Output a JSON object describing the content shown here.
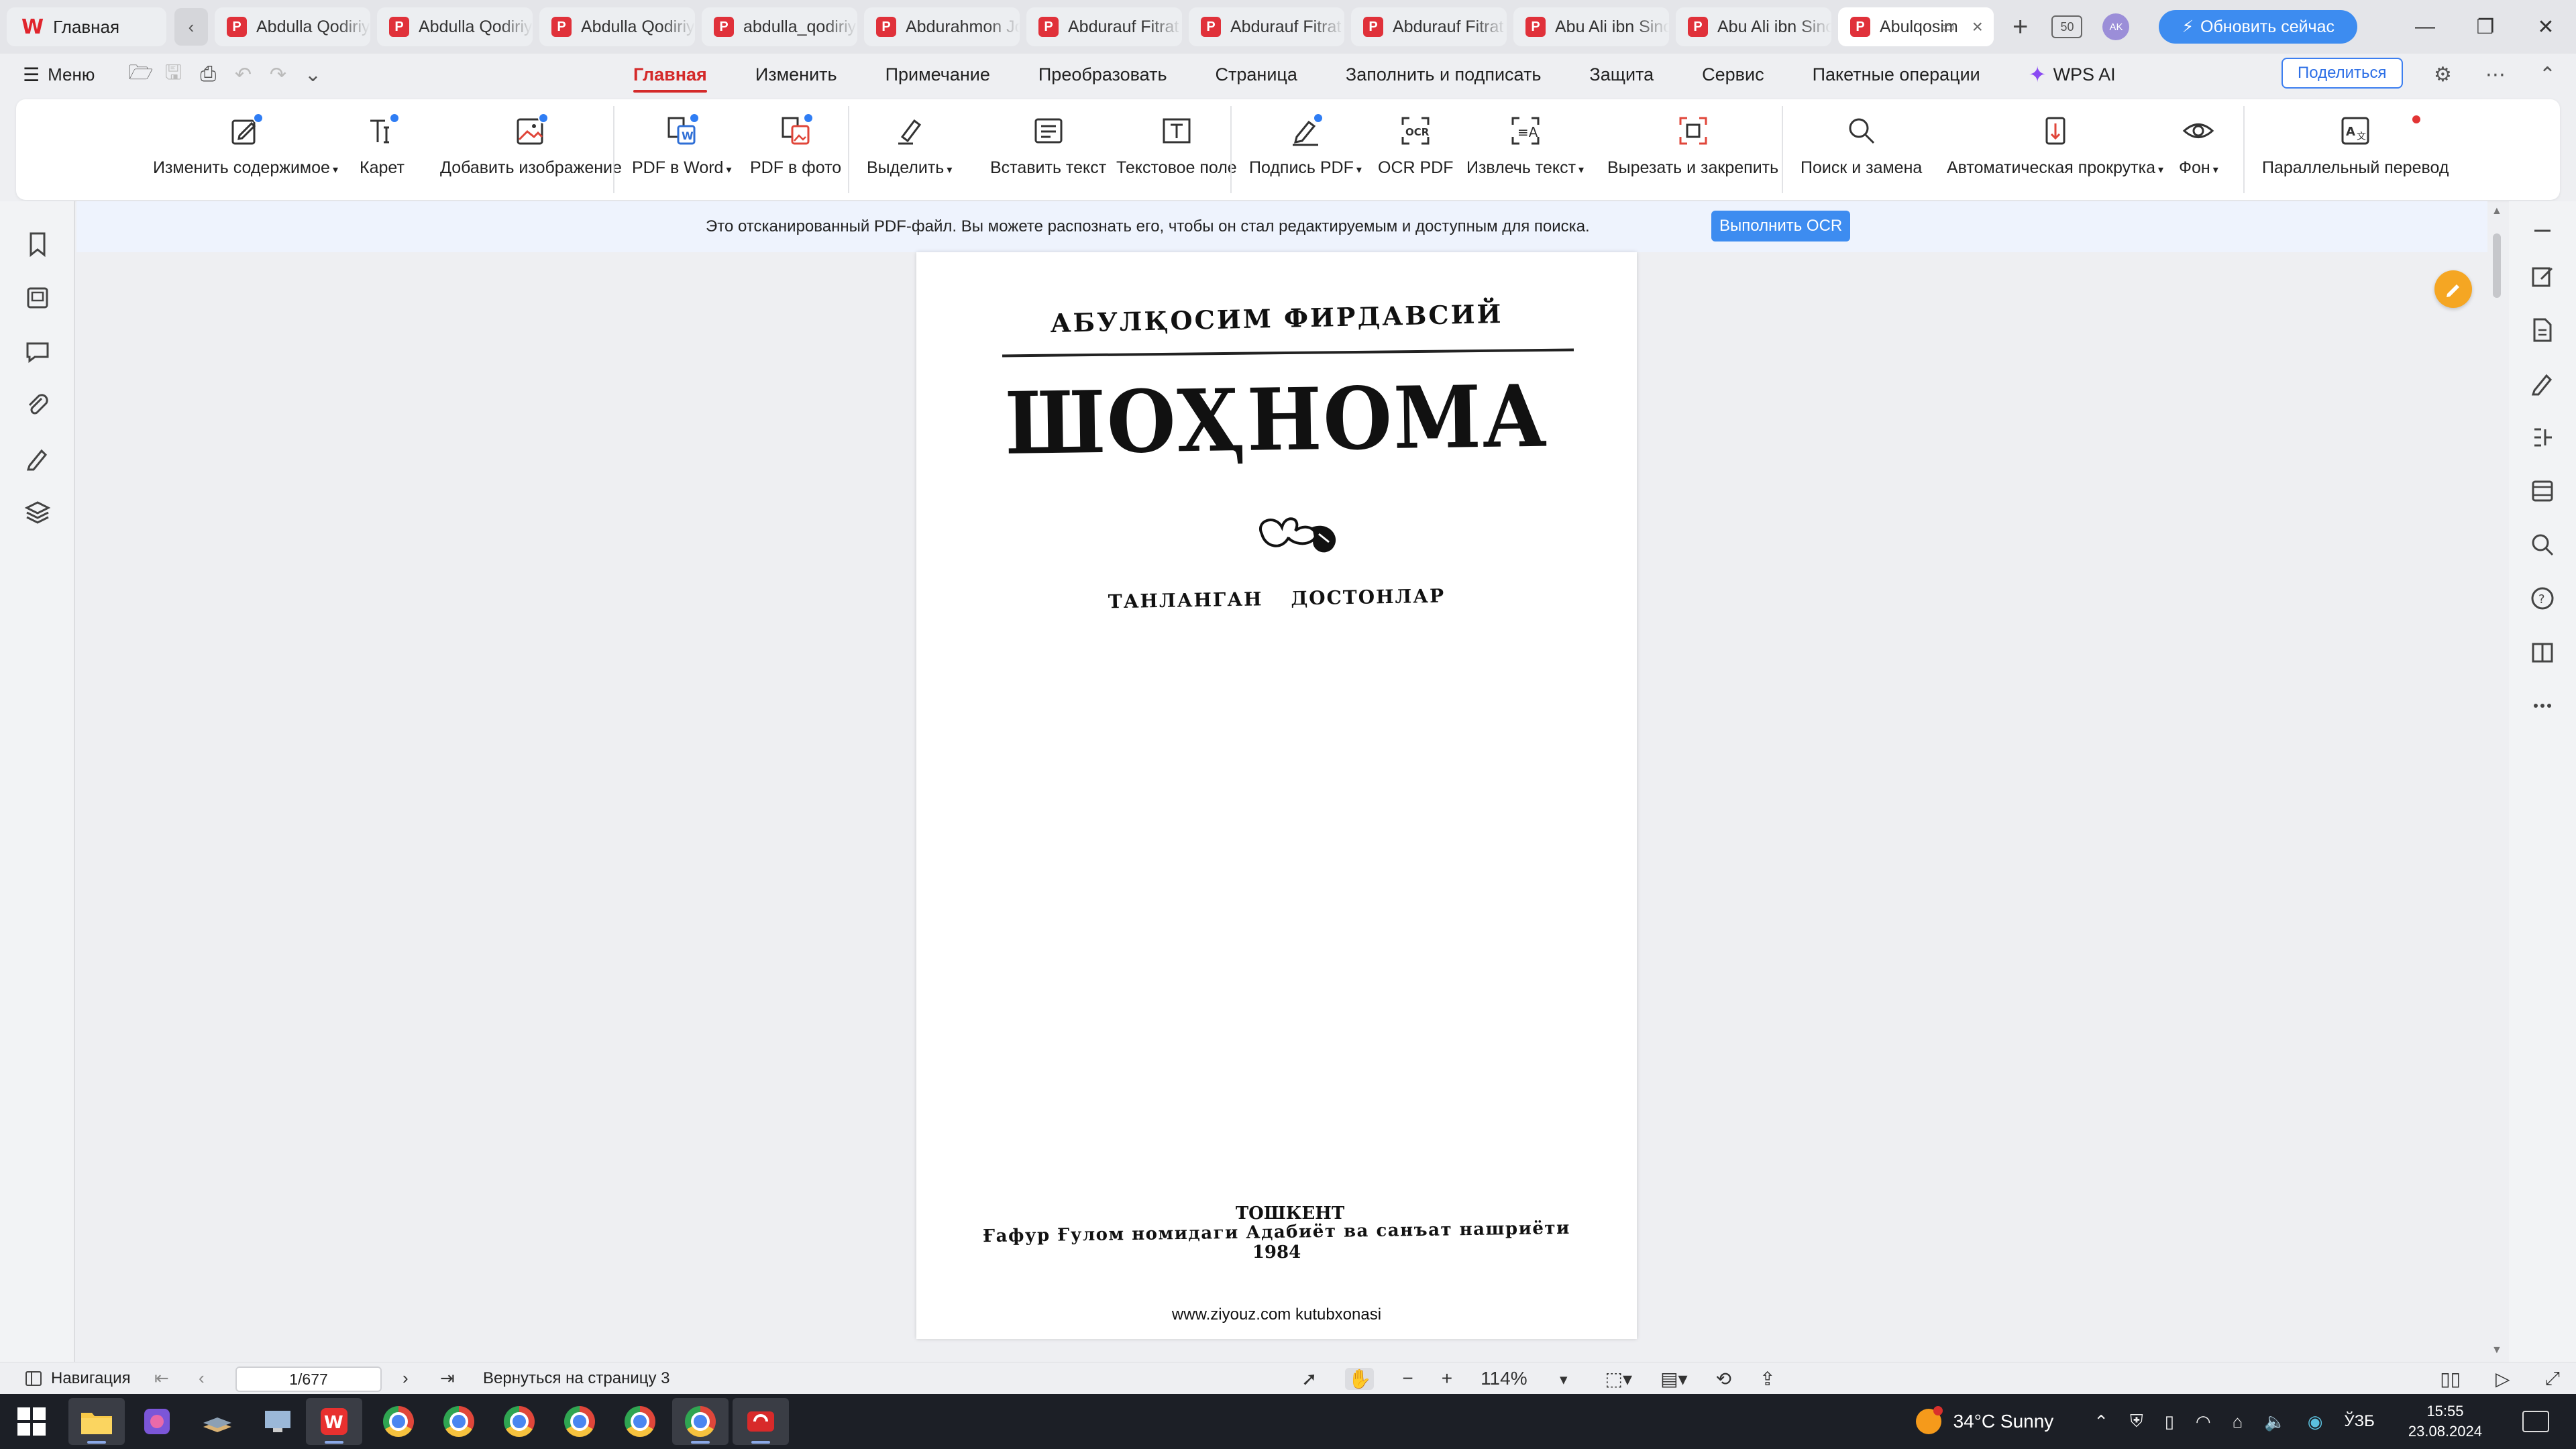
{
  "titlebar": {
    "home_label": "Главная",
    "tabs": [
      {
        "label": "Abdulla Qodiriy"
      },
      {
        "label": "Abdulla Qodiriy"
      },
      {
        "label": "Abdulla Qodiriy"
      },
      {
        "label": "abdulla_qodiriy"
      },
      {
        "label": "Abdurahmon Jomiy"
      },
      {
        "label": "Abdurauf Fitrat"
      },
      {
        "label": "Abdurauf Fitrat"
      },
      {
        "label": "Abdurauf Fitrat"
      },
      {
        "label": "Abu Ali ibn Sino"
      },
      {
        "label": "Abu Ali ibn Sino"
      },
      {
        "label": "Abulqosim"
      }
    ],
    "active_tab_index": 10,
    "plan_badge": "50",
    "avatar_initials": "AK",
    "upgrade_label": "Обновить сейчас"
  },
  "menubar": {
    "menu_label": "Меню",
    "tabs": [
      "Главная",
      "Изменить",
      "Примечание",
      "Преобразовать",
      "Страница",
      "Заполнить и подписать",
      "Защита",
      "Сервис",
      "Пакетные операции"
    ],
    "active_tab": "Главная",
    "wps_ai_label": "WPS AI",
    "share_label": "Поделиться"
  },
  "ribbon": {
    "edit_content": "Изменить содержимое",
    "caret": "Карет",
    "add_image": "Добавить изображение",
    "pdf_to_word": "PDF в Word",
    "pdf_to_photo": "PDF в фото",
    "highlight": "Выделить",
    "insert_text": "Вставить текст",
    "text_field": "Текстовое поле",
    "sign_pdf": "Подпись PDF",
    "ocr_pdf": "OCR PDF",
    "extract_text": "Извлечь текст",
    "cut_pin": "Вырезать и закрепить",
    "find_replace": "Поиск и замена",
    "auto_scroll": "Автоматическая прокрутка",
    "background": "Фон",
    "parallel_translate": "Параллельный перевод"
  },
  "ocr_banner": {
    "message": "Это отсканированный PDF-файл. Вы можете распознать его, чтобы он стал редактируемым и доступным для поиска.",
    "button": "Выполнить OCR"
  },
  "document": {
    "author": "АБУЛҚОСИМ ФИРДАВСИЙ",
    "title": "ШОҲНОМА",
    "subtitle": "ТАНЛАНГАН ДОСТОНЛАР",
    "city": "ТОШКЕНТ",
    "publisher": "Ғафур Ғулом номидаги Адабиёт ва санъат нашриёти",
    "year": "1984",
    "site": "www.ziyouz.com kutubxonasi"
  },
  "statusbar": {
    "navigation_label": "Навигация",
    "page_indicator": "1/677",
    "back_to_page": "Вернуться на страницу 3",
    "zoom": "114%"
  },
  "taskbar": {
    "weather": "34°C  Sunny",
    "language": "ЎЗБ",
    "time": "15:55",
    "date": "23.08.2024"
  },
  "colors": {
    "accent_red": "#d42a2a",
    "accent_blue": "#3d8cf0",
    "taskbar": "#1c1f26"
  }
}
